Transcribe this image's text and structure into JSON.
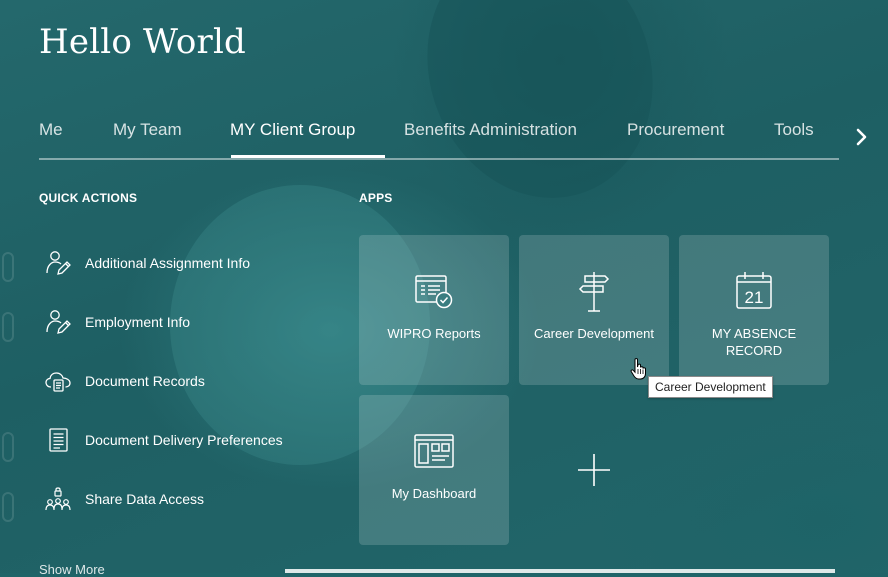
{
  "header": {
    "title": "Hello World"
  },
  "tabs": [
    {
      "label": "Me"
    },
    {
      "label": "My Team"
    },
    {
      "label": "MY Client Group"
    },
    {
      "label": "Benefits Administration"
    },
    {
      "label": "Procurement"
    },
    {
      "label": "Tools"
    }
  ],
  "active_tab": "MY Client Group",
  "quick_actions": {
    "heading": "QUICK ACTIONS",
    "items": [
      {
        "label": "Additional Assignment Info",
        "icon": "person-edit-icon"
      },
      {
        "label": "Employment Info",
        "icon": "person-edit-icon"
      },
      {
        "label": "Document Records",
        "icon": "cloud-document-icon"
      },
      {
        "label": "Document Delivery Preferences",
        "icon": "document-lines-icon"
      },
      {
        "label": "Share Data Access",
        "icon": "people-lock-icon"
      }
    ],
    "show_more": "Show More"
  },
  "apps": {
    "heading": "APPS",
    "tiles": [
      {
        "label": "WIPRO Reports",
        "icon": "report-check-icon"
      },
      {
        "label": "Career Development",
        "icon": "signpost-icon"
      },
      {
        "label": "MY ABSENCE RECORD",
        "icon": "calendar-icon",
        "calendar_day": "21"
      },
      {
        "label": "My Dashboard",
        "icon": "dashboard-icon"
      }
    ]
  },
  "tooltip": {
    "text": "Career Development"
  }
}
